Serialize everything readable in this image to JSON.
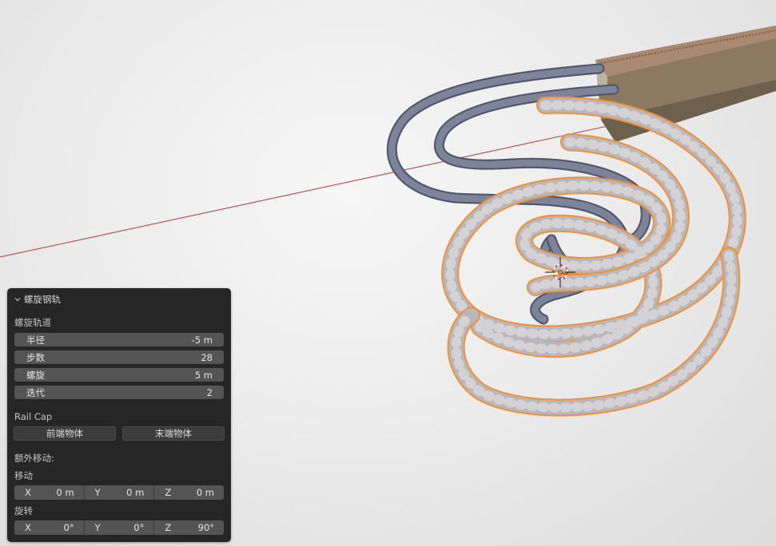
{
  "panel": {
    "title": "螺旋钢轨",
    "section_helix": "螺旋轨道",
    "fields": [
      {
        "label": "半径",
        "value": "-5 m"
      },
      {
        "label": "步数",
        "value": "28"
      },
      {
        "label": "螺旋",
        "value": "5 m"
      },
      {
        "label": "迭代",
        "value": "2"
      }
    ],
    "section_cap": "Rail Cap",
    "cap_buttons": {
      "front": "前端物体",
      "end": "末端物体"
    },
    "section_extra": "额外移动:",
    "move": {
      "label": "移动",
      "x_label": "X",
      "x": "0 m",
      "y_label": "Y",
      "y": "0 m",
      "z_label": "Z",
      "z": "0 m"
    },
    "rotate": {
      "label": "旋转",
      "x_label": "X",
      "x": "0°",
      "y_label": "Y",
      "y": "0°",
      "z_label": "Z",
      "z": "90°"
    }
  },
  "colors": {
    "selection_outline": "#f0913a",
    "rail_selected": "#c9c7c9",
    "rail_unselected": "#6a7086",
    "x_axis": "#b04040",
    "panel_bg": "#262626",
    "field_bg": "#545454"
  },
  "icons": [
    "chevron-down-icon",
    "3d-cursor-icon",
    "object-origin-icon"
  ]
}
